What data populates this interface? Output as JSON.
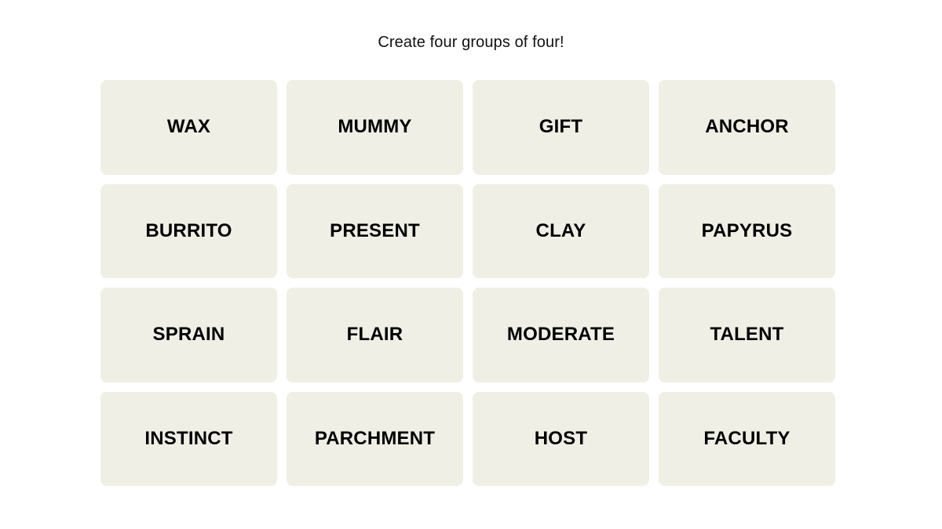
{
  "page": {
    "background_color": "#ffffff"
  },
  "instructions": {
    "text": "Create four groups of four!"
  },
  "board": {
    "rows": 4,
    "columns": 4,
    "tile_background_color": "#efefe6",
    "tile_text_color": "#000000",
    "tiles": [
      {
        "label": "WAX"
      },
      {
        "label": "MUMMY"
      },
      {
        "label": "GIFT"
      },
      {
        "label": "ANCHOR"
      },
      {
        "label": "BURRITO"
      },
      {
        "label": "PRESENT"
      },
      {
        "label": "CLAY"
      },
      {
        "label": "PAPYRUS"
      },
      {
        "label": "SPRAIN"
      },
      {
        "label": "FLAIR"
      },
      {
        "label": "MODERATE"
      },
      {
        "label": "TALENT"
      },
      {
        "label": "INSTINCT"
      },
      {
        "label": "PARCHMENT"
      },
      {
        "label": "HOST"
      },
      {
        "label": "FACULTY"
      }
    ]
  }
}
